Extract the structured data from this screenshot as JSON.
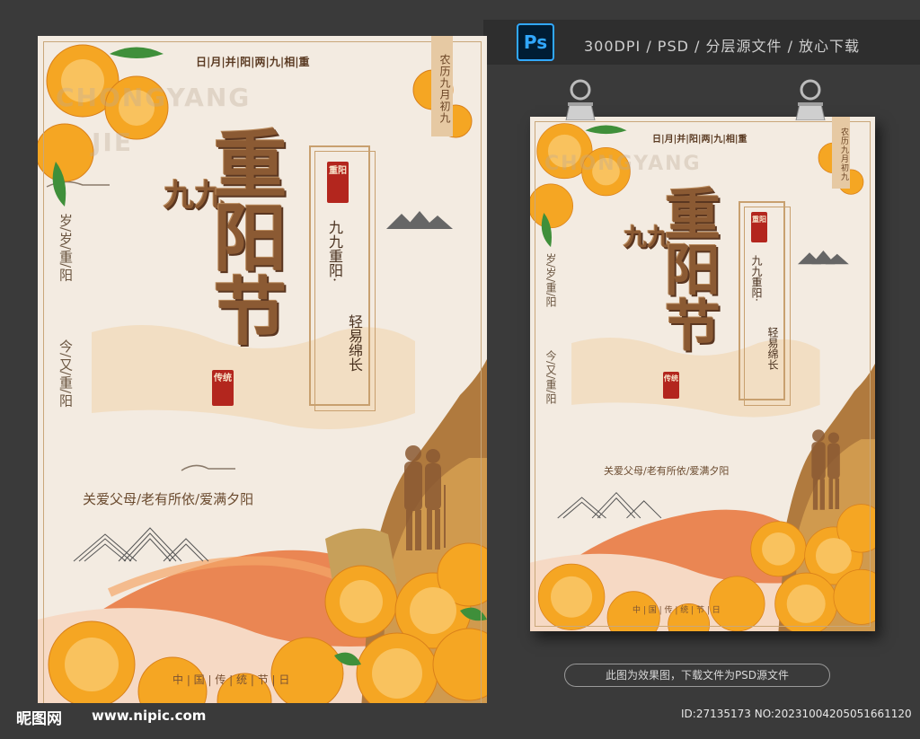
{
  "header": {
    "app_icon_label": "Ps",
    "info": "300DPI / PSD / 分层源文件 / 放心下载"
  },
  "poster": {
    "watermark_line1": "CHONGYANG",
    "watermark_line2": "JIE",
    "top_line": "日|月|并|阳|两|九|相|重",
    "ribbon": "农历九月初九",
    "left_vertical_1": "岁/岁/重/阳",
    "left_vertical_2": "今/又/重/阳",
    "title_prefix": "九九",
    "title": "重阳节",
    "seal_top": "重阳",
    "seal_bottom": "传统",
    "right_vertical_1": "九九重阳·",
    "right_vertical_2": "轻易绵长",
    "tagline": "关爱父母/老有所依/爱满夕阳",
    "bottom_line": "中 | 国 | 传 | 统 | 节 | 日"
  },
  "footer": {
    "notice": "此图为效果图，下载文件为PSD源文件",
    "site_logo": "昵图网",
    "site_url": "www.nipic.com",
    "id_text": "ID:27135173 NO:20231004205051661120"
  },
  "colors": {
    "background": "#3a3a3a",
    "paper": "#f3ebe1",
    "gold": "#c8a06f",
    "brown": "#8b5a33",
    "chrysanthemum": "#f5a623",
    "seal_red": "#b3261e"
  }
}
